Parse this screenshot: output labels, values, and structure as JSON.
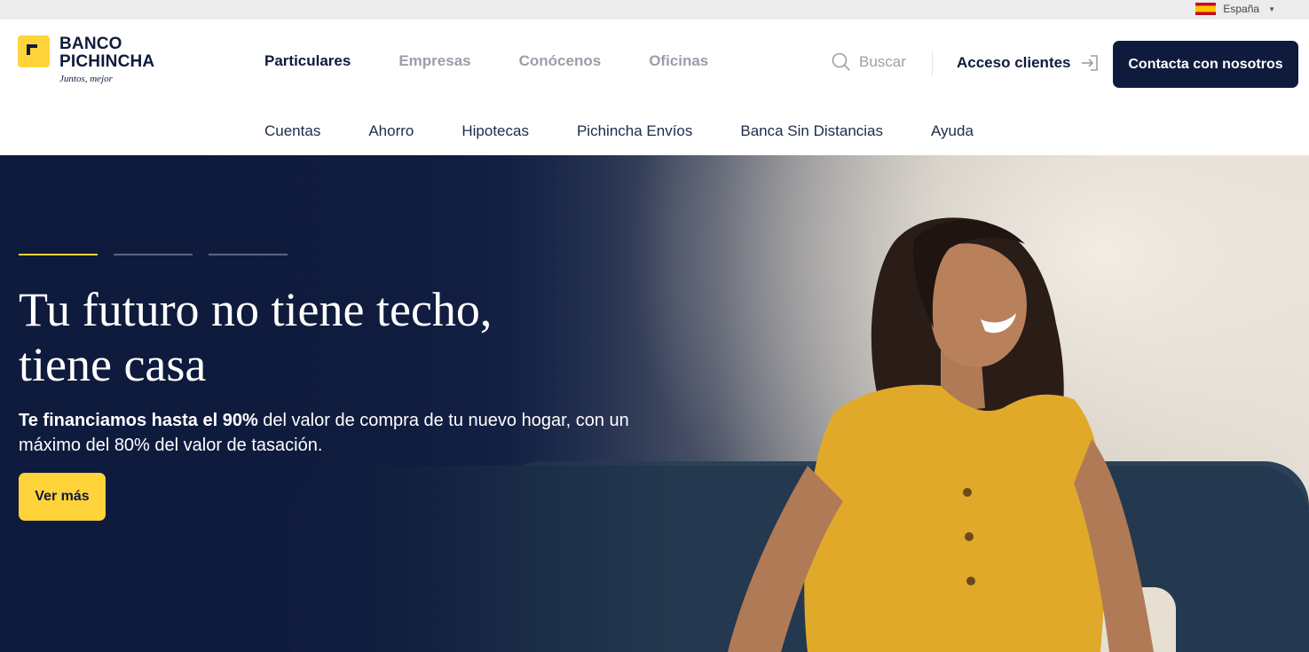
{
  "topbar": {
    "country": "España"
  },
  "brand": {
    "name_line1": "BANCO",
    "name_line2": "PICHINCHA",
    "tagline": "Juntos, mejor"
  },
  "main_nav": [
    {
      "label": "Particulares",
      "active": true
    },
    {
      "label": "Empresas",
      "active": false
    },
    {
      "label": "Conócenos",
      "active": false
    },
    {
      "label": "Oficinas",
      "active": false
    }
  ],
  "header_actions": {
    "search_label": "Buscar",
    "access_label": "Acceso clientes",
    "contact_label": "Contacta con nosotros"
  },
  "sub_nav": [
    "Cuentas",
    "Ahorro",
    "Hipotecas",
    "Pichincha Envíos",
    "Banca Sin Distancias",
    "Ayuda"
  ],
  "hero": {
    "title_line1": "Tu futuro no tiene techo,",
    "title_line2": "tiene casa",
    "text_bold": "Te financiamos hasta el 90%",
    "text_rest": " del valor de compra de tu nuevo hogar, con un máximo del 80% del valor de tasación.",
    "cta_label": "Ver más",
    "slides_total": 3,
    "slide_active": 1
  },
  "colors": {
    "navy": "#0f1b3d",
    "yellow": "#ffd33a",
    "muted": "#9a9ea8"
  }
}
